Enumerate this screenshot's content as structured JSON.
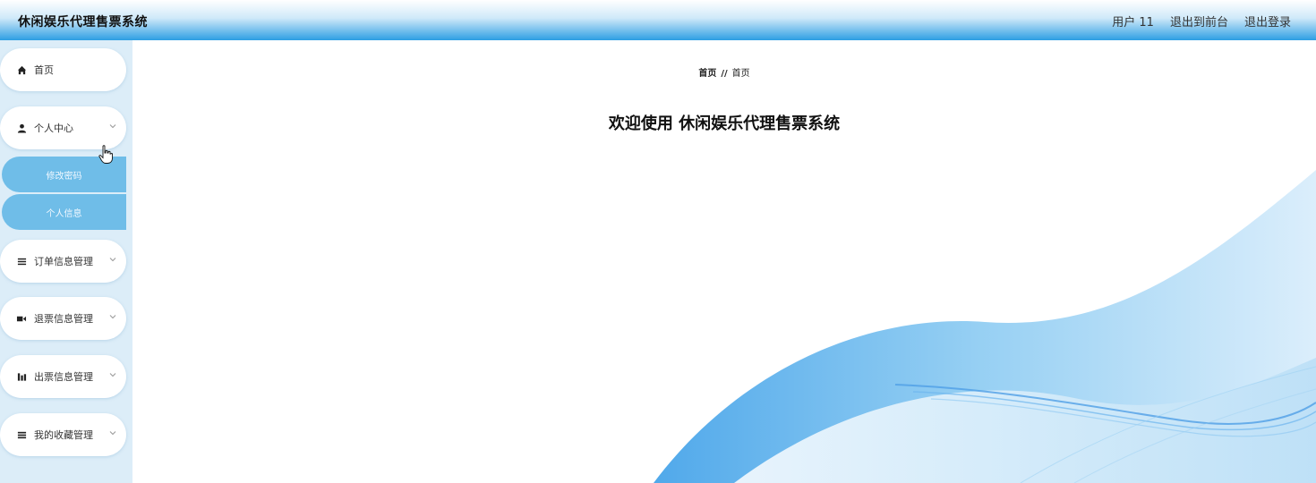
{
  "header": {
    "title": "休闲娱乐代理售票系统",
    "user": "用户 11",
    "back_to_front": "退出到前台",
    "logout": "退出登录"
  },
  "sidebar": {
    "items": [
      {
        "label": "首页",
        "icon": "home-icon"
      },
      {
        "label": "个人中心",
        "icon": "user-icon"
      },
      {
        "label": "订单信息管理",
        "icon": "list-icon"
      },
      {
        "label": "退票信息管理",
        "icon": "ticket-icon"
      },
      {
        "label": "出票信息管理",
        "icon": "chart-icon"
      },
      {
        "label": "我的收藏管理",
        "icon": "menu-icon"
      }
    ],
    "sub_items": [
      {
        "label": "修改密码"
      },
      {
        "label": "个人信息"
      }
    ]
  },
  "breadcrumb": {
    "home": "首页",
    "separator": "//",
    "current": "首页"
  },
  "main": {
    "welcome": "欢迎使用 休闲娱乐代理售票系统"
  },
  "colors": {
    "accent": "#2d9ee3",
    "submenu": "#6fbde8",
    "sidebar_bg": "#dcedf8"
  }
}
